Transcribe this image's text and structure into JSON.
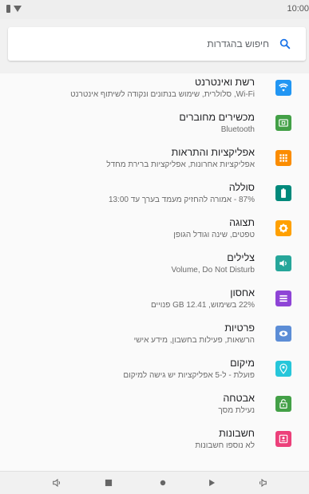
{
  "status_bar": {
    "time": "10:00"
  },
  "search": {
    "placeholder": "חיפוש בהגדרות",
    "icon": "search-icon"
  },
  "settings": [
    {
      "title": "רשת ואינטרנט",
      "subtitle": "Wi-Fi, סלולרית, שימוש בנתונים ונקודה לשיתוף אינטרנט",
      "icon": "wifi-icon",
      "color": "#2196f3"
    },
    {
      "title": "מכשירים מחוברים",
      "subtitle": "Bluetooth",
      "icon": "connected-devices-icon",
      "color": "#43a047"
    },
    {
      "title": "אפליקציות והתראות",
      "subtitle": "אפליקציות אחרונות, אפליקציות ברירת מחדל",
      "icon": "apps-grid-icon",
      "color": "#fb8c00"
    },
    {
      "title": "סוללה",
      "subtitle": "87% - אמורה להחזיק מעמד בערך עד 13:00",
      "icon": "battery-icon",
      "color": "#00897b"
    },
    {
      "title": "תצוגה",
      "subtitle": "טפטים, שינה וגודל הגופן",
      "icon": "brightness-icon",
      "color": "#ffa000"
    },
    {
      "title": "צלילים",
      "subtitle": "Volume, Do Not Disturb",
      "icon": "volume-icon",
      "color": "#26a69a"
    },
    {
      "title": "אחסון",
      "subtitle": "22% בשימוש, 12.41 GB פנויים",
      "icon": "storage-icon",
      "color": "#8e44d6"
    },
    {
      "title": "פרטיות",
      "subtitle": "הרשאות, פעילות בחשבון, מידע אישי",
      "icon": "privacy-eye-icon",
      "color": "#5c8dd6"
    },
    {
      "title": "מיקום",
      "subtitle": "פועלת - ל-5 אפליקציות יש גישה למיקום",
      "icon": "location-pin-icon",
      "color": "#26c6da"
    },
    {
      "title": "אבטחה",
      "subtitle": "נעילת מסך",
      "icon": "lock-open-icon",
      "color": "#43a047"
    },
    {
      "title": "חשבונות",
      "subtitle": "לא נוספו חשבונות",
      "icon": "account-box-icon",
      "color": "#ec407a"
    }
  ],
  "nav_bar": {
    "buttons": [
      "volume-down-icon",
      "square-icon",
      "circle-home-icon",
      "play-back-icon",
      "volume-up-icon"
    ]
  }
}
